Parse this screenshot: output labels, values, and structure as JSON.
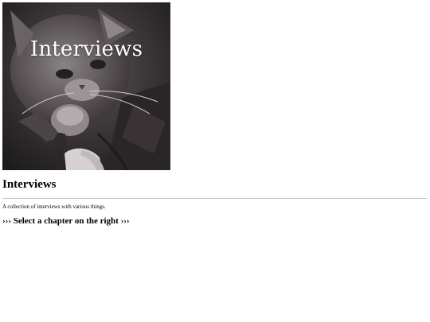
{
  "cover": {
    "title": "Interviews",
    "image": "grayscale-cat-photo"
  },
  "page": {
    "title": "Interviews",
    "description": "A collection of interviews with various things.",
    "prompt": "››› Select a chapter on the right ›››"
  }
}
